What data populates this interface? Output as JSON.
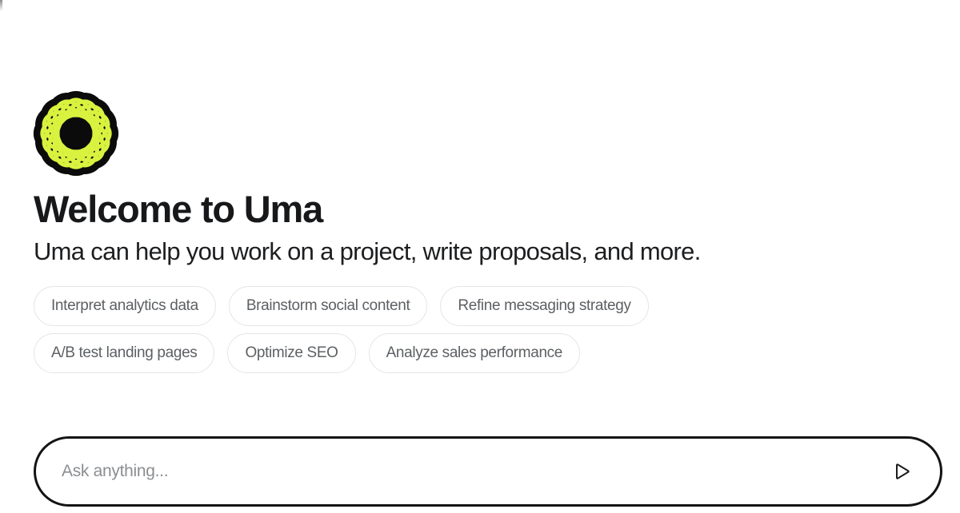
{
  "app": {
    "name": "Uma",
    "background_color": "#ffffff"
  },
  "logo": {
    "icon_name": "uma-rosette-logo",
    "petal_color": "#d8f23f",
    "blob_color": "#0b0b0b",
    "core_color": "#0b0b0b"
  },
  "welcome": {
    "title": "Welcome to Uma",
    "subtitle": "Uma can help you work on a project, write proposals, and more.",
    "title_color": "#17181a",
    "subtitle_color": "#1d1e20"
  },
  "suggestions": {
    "chip_border_color": "#e4e5e6",
    "chip_text_color": "#5d6063",
    "rows": [
      {
        "chips": [
          {
            "label": "Interpret analytics data"
          },
          {
            "label": "Brainstorm social content"
          },
          {
            "label": "Refine messaging strategy"
          }
        ]
      },
      {
        "chips": [
          {
            "label": "A/B test landing pages"
          },
          {
            "label": "Optimize SEO"
          },
          {
            "label": "Analyze sales performance"
          }
        ]
      }
    ]
  },
  "composer": {
    "placeholder": "Ask anything...",
    "value": "",
    "border_color": "#141414",
    "send_button": {
      "icon_name": "send-triangle-icon",
      "label": "Send"
    }
  }
}
